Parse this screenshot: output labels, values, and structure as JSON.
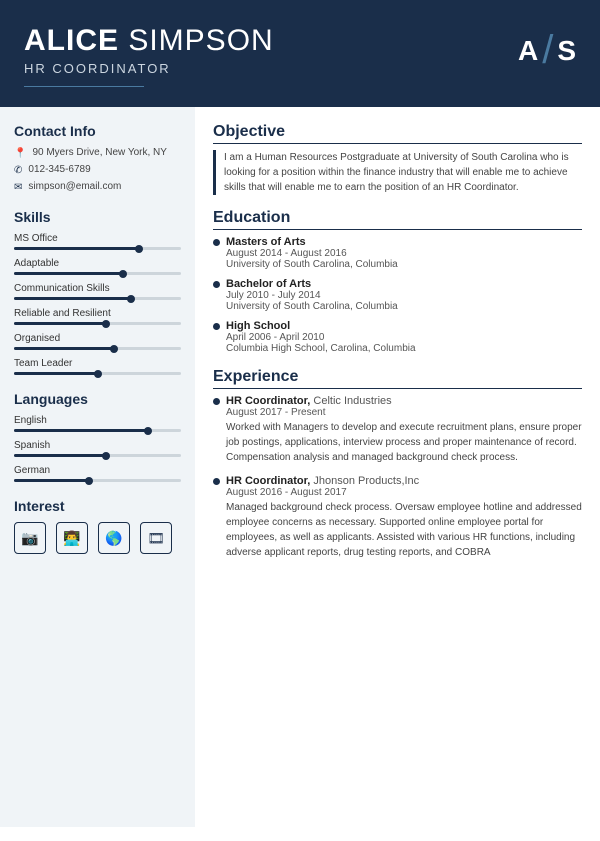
{
  "header": {
    "first_name": "ALICE",
    "last_name": " SIMPSON",
    "title": "HR COORDINATOR",
    "monogram_a": "A",
    "monogram_s": "S"
  },
  "contact": {
    "section_title": "Contact Info",
    "address": "90 Myers Drive, New York, NY",
    "phone": "012-345-6789",
    "email": "simpson@email.com"
  },
  "skills": {
    "section_title": "Skills",
    "items": [
      {
        "label": "MS Office",
        "percent": 75
      },
      {
        "label": "Adaptable",
        "percent": 65
      },
      {
        "label": "Communication Skills",
        "percent": 70
      },
      {
        "label": "Reliable and Resilient",
        "percent": 55
      },
      {
        "label": "Organised",
        "percent": 60
      },
      {
        "label": "Team Leader",
        "percent": 50
      }
    ]
  },
  "languages": {
    "section_title": "Languages",
    "items": [
      {
        "label": "English",
        "percent": 80
      },
      {
        "label": "Spanish",
        "percent": 55
      },
      {
        "label": "German",
        "percent": 45
      }
    ]
  },
  "interest": {
    "section_title": "Interest",
    "icons": [
      "camera",
      "monitor-person",
      "globe",
      "video"
    ]
  },
  "objective": {
    "section_title": "Objective",
    "text": "I am a Human Resources Postgraduate at University of South Carolina who is looking for a position within the finance industry that will enable me to achieve skills that will enable me to earn the position of an HR Coordinator."
  },
  "education": {
    "section_title": "Education",
    "items": [
      {
        "degree": "Masters of Arts",
        "dates": "August 2014 - August 2016",
        "school": "University of South Carolina, Columbia"
      },
      {
        "degree": "Bachelor of Arts",
        "dates": "July 2010 - July 2014",
        "school": "University of South Carolina, Columbia"
      },
      {
        "degree": "High School",
        "dates": "April 2006 - April 2010",
        "school": "Columbia High School, Carolina, Columbia"
      }
    ]
  },
  "experience": {
    "section_title": "Experience",
    "items": [
      {
        "title": "HR Coordinator",
        "company": "Celtic Industries",
        "dates": "August 2017 - Present",
        "description": "Worked with Managers to develop and execute recruitment plans, ensure proper job postings, applications, interview process and proper maintenance of record. Compensation analysis and managed background check process."
      },
      {
        "title": "HR Coordinator",
        "company": "Jhonson Products,Inc",
        "dates": "August 2016 - August 2017",
        "description": "Managed background check process. Oversaw employee hotline and addressed employee concerns as necessary. Supported online employee portal for employees, as well as applicants. Assisted with various HR functions, including adverse applicant reports, drug testing reports, and COBRA"
      }
    ]
  }
}
